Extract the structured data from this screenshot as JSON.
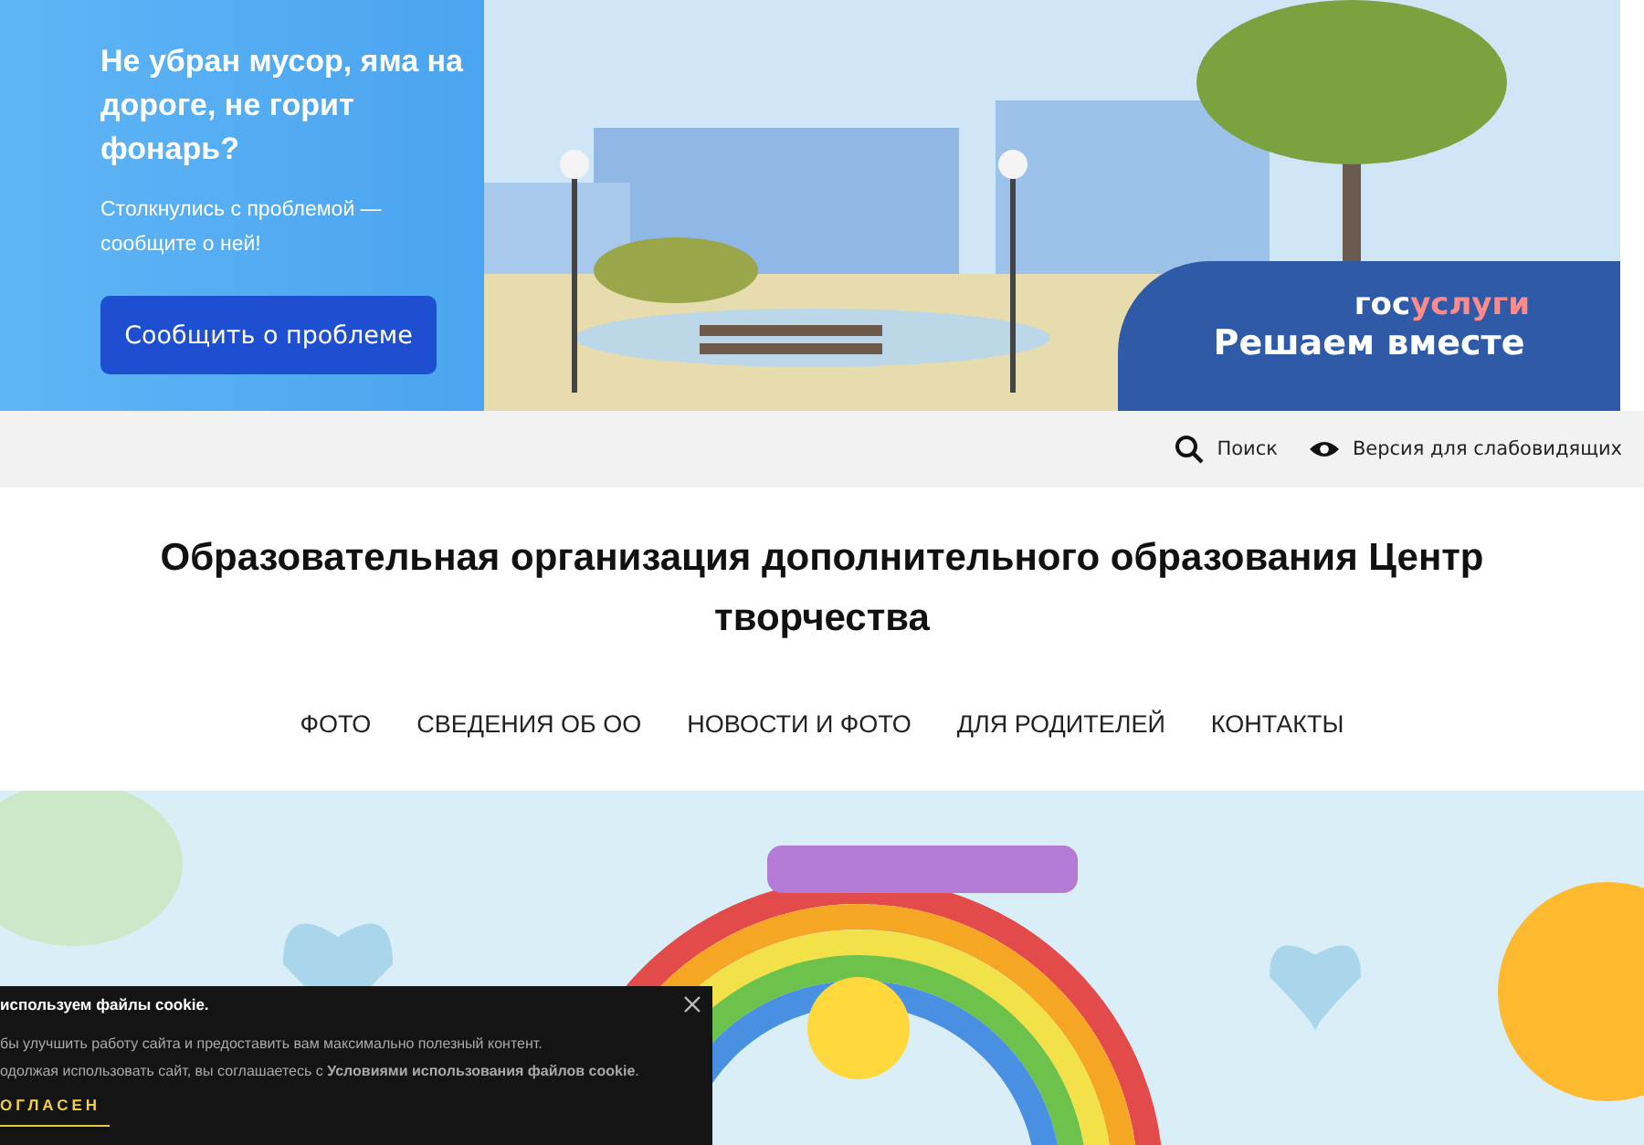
{
  "promo_banner": {
    "heading": "Не убран мусор, яма на дороге, не горит фонарь?",
    "text": "Столкнулись с проблемой — сообщите о ней!",
    "button": "Сообщить о проблеме",
    "brand_part_1": "гос",
    "brand_part_2": "услуги",
    "slogan": "Решаем вместе"
  },
  "top_bar": {
    "search": "Поиск",
    "accessibility": "Версия для слабовидящих"
  },
  "site_title": "Образовательная организация дополнительного образования Центр творчества",
  "nav": [
    {
      "label": "ФОТО"
    },
    {
      "label": "СВЕДЕНИЯ ОБ ОО"
    },
    {
      "label": "НОВОСТИ И ФОТО"
    },
    {
      "label": "ДЛЯ РОДИТЕЛЕЙ"
    },
    {
      "label": "КОНТАКТЫ"
    }
  ],
  "cookie_notice": {
    "title": "используем файлы cookie.",
    "line_1": "бы улучшить работу сайта и предоставить вам максимально полезный контент.",
    "line_2": "одолжая использовать сайт, вы соглашаетесь с **Условиями использования файлов cookie**.",
    "accept": "ОГЛАСЕН"
  }
}
